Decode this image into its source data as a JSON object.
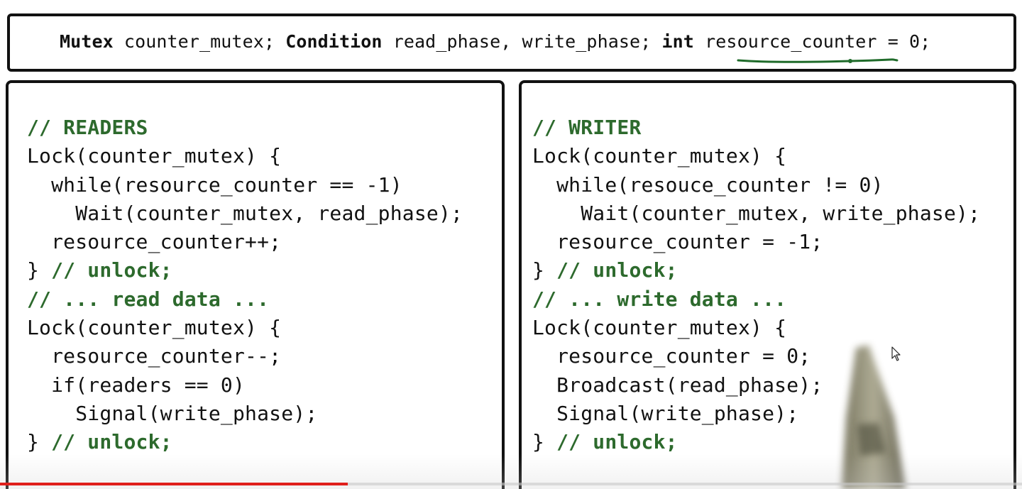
{
  "declaration": {
    "kw_mutex": "Mutex",
    "txt_mutex": " counter_mutex; ",
    "kw_condition": "Condition",
    "txt_condition": " read_phase, write_phase; ",
    "kw_int": "int",
    "txt_int_space": " ",
    "var_resource": "resource_counter",
    "txt_assign": " = 0;"
  },
  "readers": {
    "lines": [
      "// READERS",
      "Lock(counter_mutex) {",
      "  while(resource_counter == -1)",
      "    Wait(counter_mutex, read_phase);",
      "  resource_counter++;",
      "} ",
      "// ... read data ...",
      "Lock(counter_mutex) {",
      "  resource_counter--;",
      "  if(readers == 0)",
      "    Signal(write_phase);",
      "} "
    ],
    "unlock_comment_1": "// unlock;",
    "unlock_comment_2": "// unlock;"
  },
  "writer": {
    "lines": [
      "// WRITER",
      "Lock(counter_mutex) {",
      "  while(resouce_counter != 0)",
      "    Wait(counter_mutex, write_phase);",
      "  resource_counter = -1;",
      "} ",
      "// ... write data ...",
      "Lock(counter_mutex) {",
      "  resource_counter = 0;",
      "  Broadcast(read_phase);",
      "  Signal(write_phase);",
      "} "
    ],
    "unlock_comment_1": "// unlock;",
    "unlock_comment_2": "// unlock;"
  },
  "video": {
    "progress_fraction": 0.34,
    "progress_color": "#e0201c"
  },
  "colors": {
    "comment": "#2d6a2d",
    "annotation_ink": "#1f6b2a",
    "border": "#111111"
  },
  "icons": {
    "cursor": "mouse-pointer-icon",
    "pen": "stylus-pen-icon"
  }
}
